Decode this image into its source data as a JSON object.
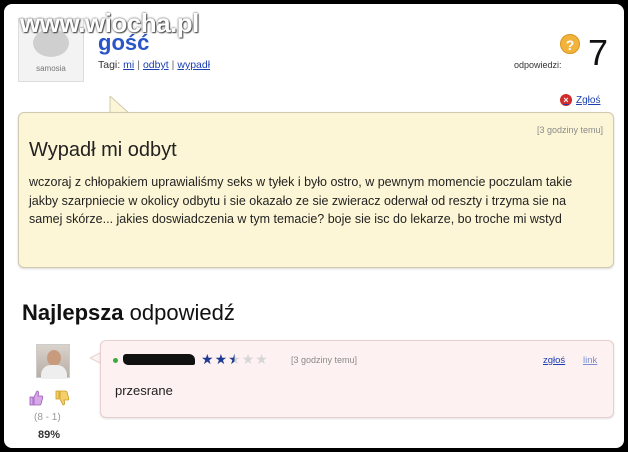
{
  "watermark": "www.wiocha.pl",
  "question": {
    "avatar_logo_text": "samosia",
    "author": "gość",
    "tags_label": "Tagi:",
    "tags": [
      "mi",
      "odbyt",
      "wypadł"
    ],
    "answers_label": "odpowiedzi:",
    "answers_count": "7",
    "report_label": "Zgłoś",
    "time": "[3 godziny temu]",
    "title": "Wypadł mi odbyt",
    "body": "wczoraj z chłopakiem uprawialiśmy seks w tyłek i było ostro, w pewnym momencie poczulam takie jakby szarpniecie w okolicy odbytu i sie okazało ze sie zwieracz oderwał od reszty i trzyma sie na samej skórze... jakies doswiadczenia w tym temacie? boje sie isc do lekarze, bo troche mi wstyd"
  },
  "best_answer": {
    "heading_bold": "Najlepsza",
    "heading_rest": "odpowiedź",
    "rating_stars": 2.5,
    "rating_max": 5,
    "time": "[3 godziny temu]",
    "report_label": "zgłoś",
    "link_label": "link",
    "body": "przesrane",
    "votes": "(8 - 1)",
    "percent": "89%"
  },
  "colors": {
    "question_bg": "#fdf6d6",
    "answer_bg": "#fdf1f1",
    "link": "#1b3fb0",
    "author": "#2a55c8"
  }
}
